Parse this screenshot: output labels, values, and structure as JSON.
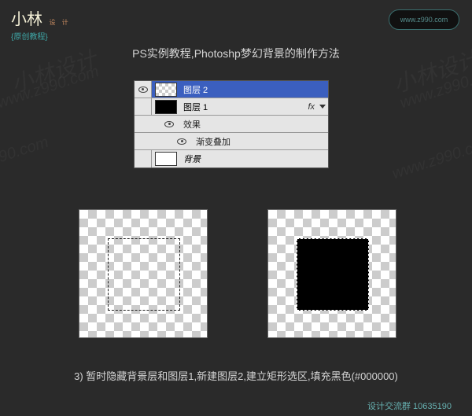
{
  "logo": {
    "main": "小林",
    "sub": "设 计",
    "bottom": "{原创教程}"
  },
  "url_cloud": "www.z990.com",
  "title": "PS实例教程,Photoshp梦幻背景的制作方法",
  "watermark": "小林设计\nwww.z990.com",
  "layers": {
    "row1": "图层 2",
    "row2": "图层 1",
    "fx_tag": "fx",
    "effects": "效果",
    "effect_item": "渐变叠加",
    "row3": "背景"
  },
  "caption": "3) 暂时隐藏背景层和图层1,新建图层2,建立矩形选区,填充黑色(#000000)",
  "footer": "设计交流群 10635190"
}
